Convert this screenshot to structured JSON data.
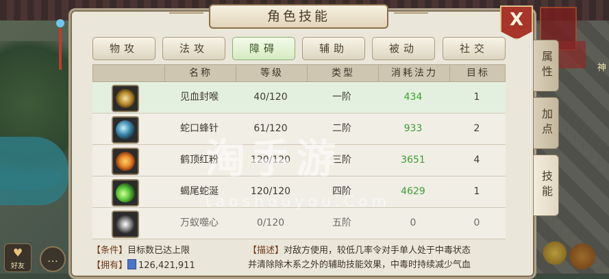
{
  "window": {
    "title": "角色技能",
    "close_label": "X"
  },
  "tabs": [
    {
      "label": "物攻",
      "active": false
    },
    {
      "label": "法攻",
      "active": false
    },
    {
      "label": "障碍",
      "active": true
    },
    {
      "label": "辅助",
      "active": false
    },
    {
      "label": "被动",
      "active": false
    },
    {
      "label": "社交",
      "active": false
    }
  ],
  "side_tabs": [
    {
      "label": "属性",
      "active": false
    },
    {
      "label": "加点",
      "active": false
    },
    {
      "label": "技能",
      "active": true
    }
  ],
  "table": {
    "headers": [
      "名称",
      "等级",
      "类型",
      "消耗法力",
      "目标"
    ],
    "rows": [
      {
        "icon": "blood-seal-icon",
        "name": "见血封喉",
        "level": "40/120",
        "type": "一阶",
        "mana": "434",
        "target": "1",
        "selected": true
      },
      {
        "icon": "snake-needle-icon",
        "name": "蛇口蜂针",
        "level": "61/120",
        "type": "二阶",
        "mana": "933",
        "target": "2",
        "selected": false
      },
      {
        "icon": "crane-crest-icon",
        "name": "鹤顶红粉",
        "level": "120/120",
        "type": "三阶",
        "mana": "3651",
        "target": "4",
        "selected": false
      },
      {
        "icon": "scorpion-tail-icon",
        "name": "蝎尾蛇涎",
        "level": "120/120",
        "type": "四阶",
        "mana": "4629",
        "target": "1",
        "selected": false
      },
      {
        "icon": "ant-heart-icon",
        "name": "万蚁噬心",
        "level": "0/120",
        "type": "五阶",
        "mana": "0",
        "target": "0",
        "selected": false
      }
    ]
  },
  "condition": {
    "label": "【条件】",
    "text": "目标数已达上限"
  },
  "owned": {
    "label": "【拥有】",
    "value": "126,421,911"
  },
  "description": {
    "label": "【描述】",
    "line1": "对敌方使用，较低几率令对手单人处于中毒状态",
    "line2": "并清除除木系之外的辅助技能效果，中毒时持续减少气血"
  },
  "left_buttons": {
    "friend_label": "好友",
    "chat_icon": "chat-icon"
  },
  "watermark": {
    "main": "淘手游",
    "sub": "taoshouyou.Com"
  },
  "background": {
    "sign": "神"
  },
  "colors": {
    "mana_green": "#3a9e2e",
    "close_red": "#a8342a",
    "active_tab_green": "#d6eac2"
  }
}
